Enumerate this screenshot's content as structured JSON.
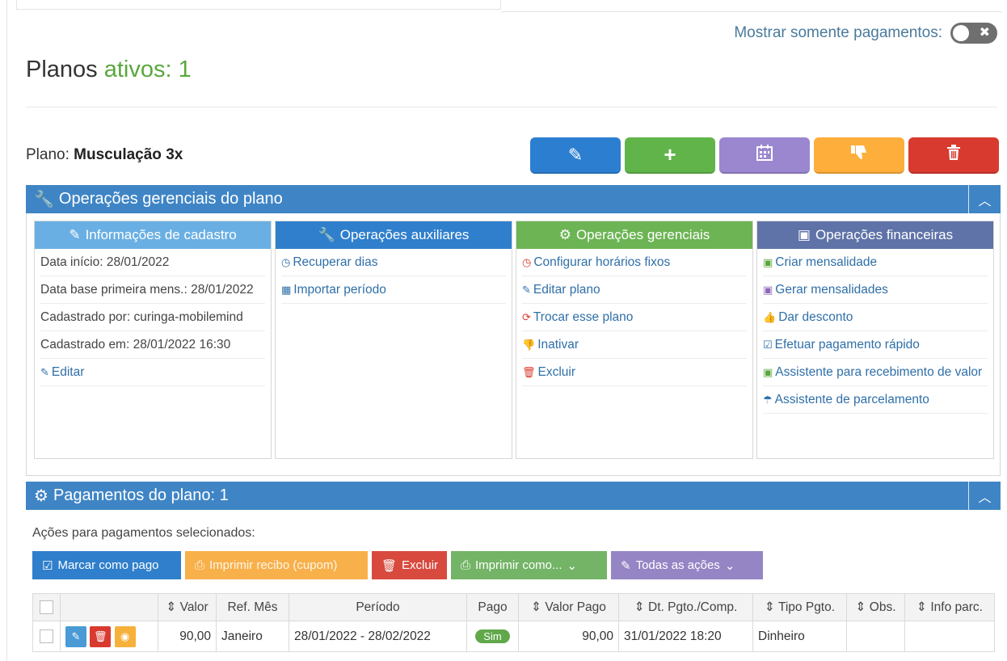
{
  "header": {
    "toggle_label": "Mostrar somente pagamentos:",
    "toggle_icon": "times-icon",
    "title_prefix": "Planos",
    "title_highlight": "ativos: 1",
    "plan_label": "Plano:",
    "plan_name": "Musculação 3x"
  },
  "action_buttons": [
    {
      "name": "edit-plan-button",
      "icon": "pencil-icon",
      "color": "#2c7fd0"
    },
    {
      "name": "add-plan-button",
      "icon": "plus-icon",
      "color": "#61b44a"
    },
    {
      "name": "calendar-button",
      "icon": "calendar-icon",
      "color": "#9b87cf"
    },
    {
      "name": "deactivate-button",
      "icon": "thumbs-down-icon",
      "color": "#fdae3b"
    },
    {
      "name": "delete-button",
      "icon": "trash-icon",
      "color": "#d93a2f"
    }
  ],
  "ops_panel": {
    "title": "Operações gerenciais do plano",
    "columns": {
      "cadastro": {
        "title": "Informações de cadastro",
        "items": [
          "Data início: 28/01/2022",
          "Data base primeira mens.: 28/01/2022",
          "Cadastrado por: curinga-mobilemind",
          "Cadastrado em: 28/01/2022 16:30",
          "Editar"
        ]
      },
      "auxiliares": {
        "title": "Operações auxiliares",
        "items": [
          "Recuperar dias",
          "Importar período"
        ]
      },
      "gerenciais": {
        "title": "Operações gerenciais",
        "items": [
          "Configurar horários fixos",
          "Editar plano",
          "Trocar esse plano",
          "Inativar",
          "Excluir"
        ]
      },
      "financeiras": {
        "title": "Operações financeiras",
        "items": [
          "Criar mensalidade",
          "Gerar mensalidades",
          "Dar desconto",
          "Efetuar pagamento rápido",
          "Assistente para recebimento de valor",
          "Assistente de parcelamento"
        ]
      }
    }
  },
  "payments_panel": {
    "title": "Pagamentos do plano: 1",
    "actions_label": "Ações para pagamentos selecionados:",
    "bulk_buttons": {
      "mark_paid": "Marcar como pago",
      "print_receipt": "Imprimir recibo (cupom)",
      "delete": "Excluir",
      "print_as": "Imprimir como...",
      "all_actions": "Todas as ações"
    },
    "table": {
      "headers": {
        "valor": "Valor",
        "ref_mes": "Ref. Mês",
        "periodo": "Período",
        "pago": "Pago",
        "valor_pago": "Valor Pago",
        "dt_pgto": "Dt. Pgto./Comp.",
        "tipo_pgto": "Tipo Pgto.",
        "obs": "Obs.",
        "info_parc": "Info parc."
      },
      "rows": [
        {
          "valor": "90,00",
          "ref_mes": "Janeiro",
          "periodo": "28/01/2022 - 28/02/2022",
          "pago": "Sim",
          "valor_pago": "90,00",
          "dt_pgto": "31/01/2022 18:20",
          "tipo_pgto": "Dinheiro",
          "obs": "",
          "info_parc": ""
        }
      ]
    }
  }
}
